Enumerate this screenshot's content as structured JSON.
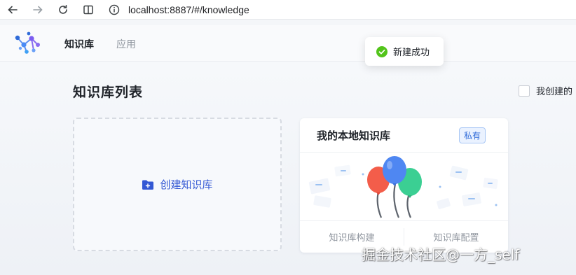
{
  "browser": {
    "url": "localhost:8887/#/knowledge"
  },
  "header": {
    "tabs": [
      {
        "label": "知识库",
        "active": true
      },
      {
        "label": "应用",
        "active": false
      }
    ]
  },
  "main": {
    "title": "知识库列表",
    "filter_label": "我创建的",
    "create_label": "创建知识库"
  },
  "knowledge_card": {
    "title": "我的本地知识库",
    "badge": "私有",
    "actions": [
      "知识库构建",
      "知识库配置"
    ]
  },
  "toast": {
    "text": "新建成功",
    "color": "#52c41a"
  },
  "watermark": "掘金技术社区@一方_self",
  "colors": {
    "accent": "#3358d4",
    "badge": "#2f6bd8"
  }
}
